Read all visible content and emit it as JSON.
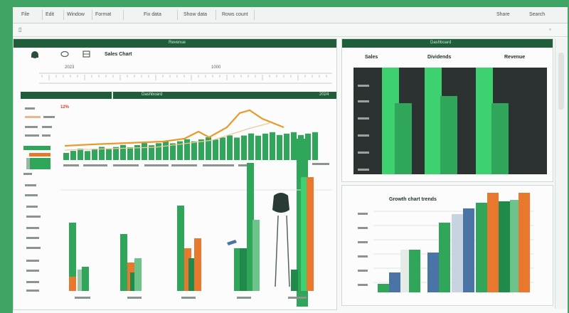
{
  "menubar": {
    "items": [
      "File",
      "Edit",
      "Window",
      "Format",
      "Fix data",
      "Show data",
      "Rows count"
    ],
    "right_items": [
      "Share",
      "Search"
    ]
  },
  "toolbar": {
    "label": "Sales Chart",
    "row_labels": [
      "2023",
      "1000"
    ],
    "panel_title": "Revenue",
    "section_bar_label": "Dashboard",
    "section_bar_right": "2024",
    "legend_small": "12%"
  },
  "right_panel": {
    "title": "Dashboard",
    "labels": [
      "Sales",
      "Dividends",
      "Revenue"
    ]
  },
  "bottom_right": {
    "title": "Growth chart trends"
  },
  "colors": {
    "frame_green": "#3fa464",
    "dark_green": "#1f5e38",
    "bar_green": "#2fa65a",
    "bright_green": "#3dd16f",
    "orange": "#e8782e",
    "dark_panel": "#2c3231",
    "blue": "#4b74a6"
  }
}
